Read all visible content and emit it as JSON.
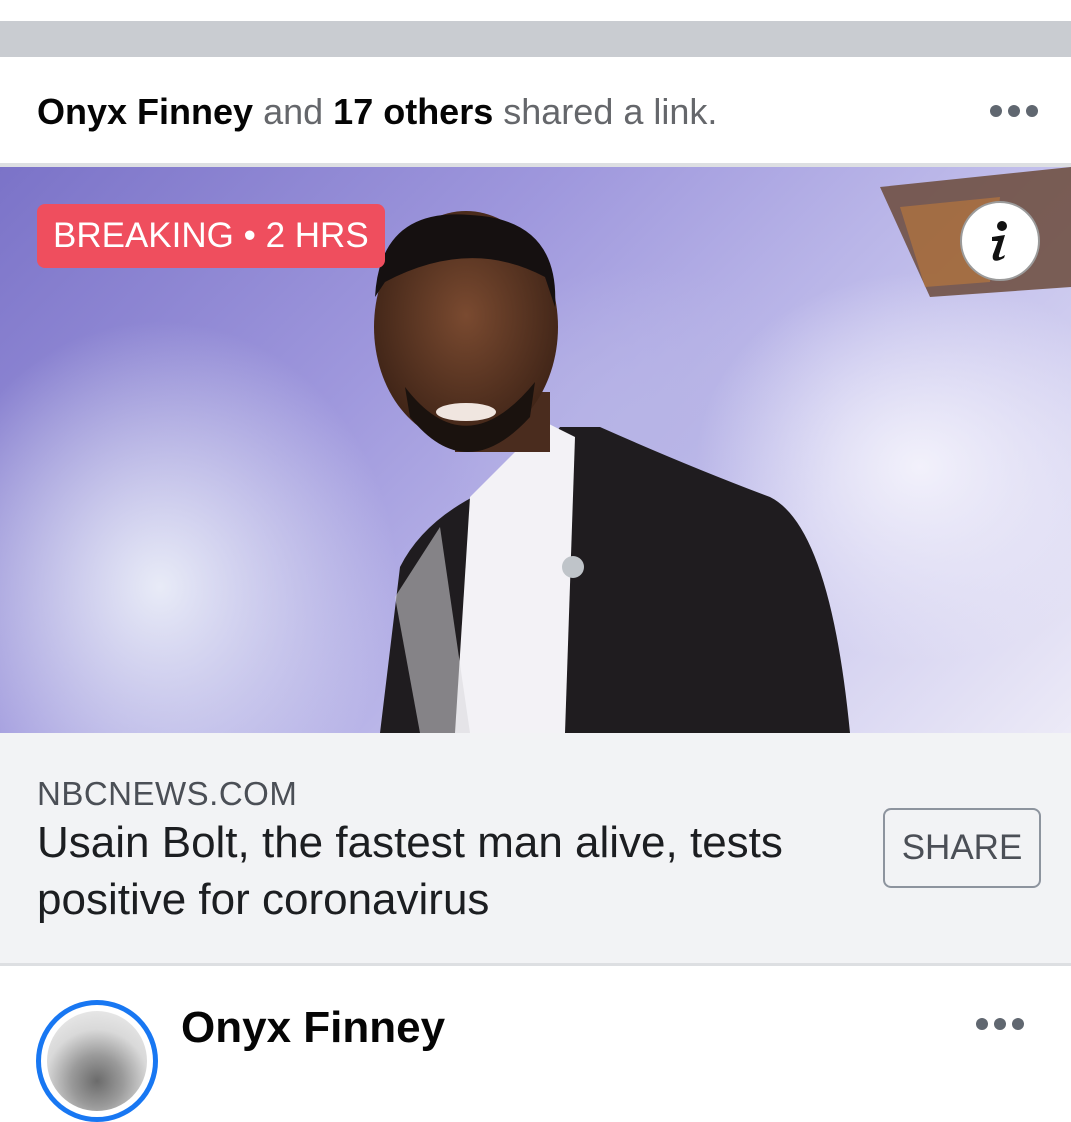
{
  "feed_story": {
    "actor_name": "Onyx Finney",
    "conjunction": "and",
    "others_count": "17 others",
    "action": "shared a link."
  },
  "link_preview": {
    "badge": "BREAKING • 2 HRS",
    "info_glyph": "i",
    "domain": "NBCNEWS.COM",
    "headline": "Usain Bolt, the fastest man alive, tests positive for coronavirus",
    "share_label": "SHARE"
  },
  "next_post": {
    "author_name": "Onyx Finney"
  },
  "icons": {
    "header_more": "more-options-icon",
    "info": "info-icon",
    "post_more": "more-options-icon"
  },
  "colors": {
    "badge_bg": "#ef4e5e",
    "avatar_ring": "#1877f2",
    "separator": "#c9ccd1"
  }
}
